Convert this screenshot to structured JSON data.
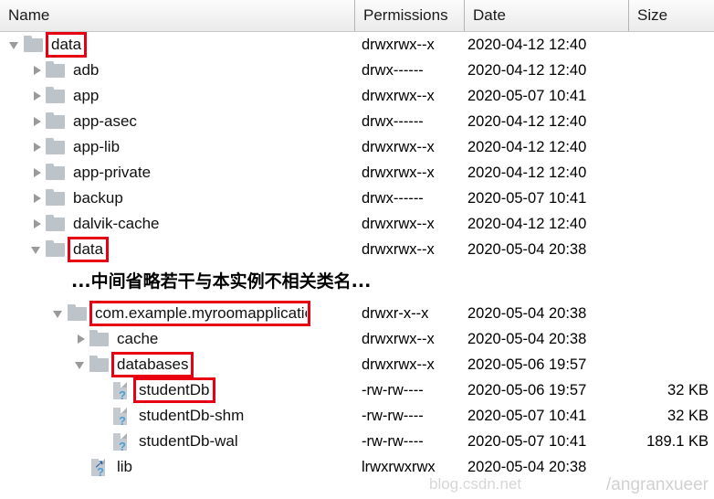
{
  "columns": {
    "name": "Name",
    "permissions": "Permissions",
    "date": "Date",
    "size": "Size"
  },
  "note": {
    "text": "...中间省略若干与本实例不相关类名..."
  },
  "watermark": {
    "text": "/angranxueer",
    "text2": "blog.csdn.net"
  },
  "colors": {
    "highlight": "#e60012",
    "folder": "#bcc3c9",
    "file": "#c4cad0",
    "badge": "#4a9fd8",
    "header_bg": "#f3f3f3"
  },
  "rows": [
    {
      "name": "data",
      "indent": 0,
      "icon": "folder-icon",
      "twisty": "expanded",
      "permissions": "drwxrwx--x",
      "date": "2020-04-12 12:40",
      "size": "",
      "highlight": true
    },
    {
      "name": "adb",
      "indent": 1,
      "icon": "folder-icon",
      "twisty": "collapsed",
      "permissions": "drwx------",
      "date": "2020-04-12 12:40",
      "size": "",
      "highlight": false
    },
    {
      "name": "app",
      "indent": 1,
      "icon": "folder-icon",
      "twisty": "collapsed",
      "permissions": "drwxrwx--x",
      "date": "2020-05-07 10:41",
      "size": "",
      "highlight": false
    },
    {
      "name": "app-asec",
      "indent": 1,
      "icon": "folder-icon",
      "twisty": "collapsed",
      "permissions": "drwx------",
      "date": "2020-04-12 12:40",
      "size": "",
      "highlight": false
    },
    {
      "name": "app-lib",
      "indent": 1,
      "icon": "folder-icon",
      "twisty": "collapsed",
      "permissions": "drwxrwx--x",
      "date": "2020-04-12 12:40",
      "size": "",
      "highlight": false
    },
    {
      "name": "app-private",
      "indent": 1,
      "icon": "folder-icon",
      "twisty": "collapsed",
      "permissions": "drwxrwx--x",
      "date": "2020-04-12 12:40",
      "size": "",
      "highlight": false
    },
    {
      "name": "backup",
      "indent": 1,
      "icon": "folder-icon",
      "twisty": "collapsed",
      "permissions": "drwx------",
      "date": "2020-05-07 10:41",
      "size": "",
      "highlight": false
    },
    {
      "name": "dalvik-cache",
      "indent": 1,
      "icon": "folder-icon",
      "twisty": "collapsed",
      "permissions": "drwxrwx--x",
      "date": "2020-04-12 12:40",
      "size": "",
      "highlight": false
    },
    {
      "name": "data",
      "indent": 1,
      "icon": "folder-icon",
      "twisty": "expanded",
      "permissions": "drwxrwx--x",
      "date": "2020-05-04 20:38",
      "size": "",
      "highlight": true
    },
    {
      "name": "com.example.myroomapplicatio",
      "indent": 2,
      "icon": "folder-icon",
      "twisty": "expanded",
      "permissions": "drwxr-x--x",
      "date": "2020-05-04 20:38",
      "size": "",
      "highlight": true,
      "wide": true
    },
    {
      "name": "cache",
      "indent": 3,
      "icon": "folder-icon",
      "twisty": "collapsed",
      "permissions": "drwxrwx--x",
      "date": "2020-05-04 20:38",
      "size": "",
      "highlight": false
    },
    {
      "name": "databases",
      "indent": 3,
      "icon": "folder-icon",
      "twisty": "expanded",
      "permissions": "drwxrwx--x",
      "date": "2020-05-06 19:57",
      "size": "",
      "highlight": true
    },
    {
      "name": "studentDb",
      "indent": 4,
      "icon": "file-unknown-icon",
      "twisty": "none",
      "permissions": "-rw-rw----",
      "date": "2020-05-06 19:57",
      "size": "32 KB",
      "highlight": true
    },
    {
      "name": "studentDb-shm",
      "indent": 4,
      "icon": "file-unknown-icon",
      "twisty": "none",
      "permissions": "-rw-rw----",
      "date": "2020-05-07 10:41",
      "size": "32 KB",
      "highlight": false
    },
    {
      "name": "studentDb-wal",
      "indent": 4,
      "icon": "file-unknown-icon",
      "twisty": "none",
      "permissions": "-rw-rw----",
      "date": "2020-05-07 10:41",
      "size": "189.1 KB",
      "highlight": false
    },
    {
      "name": "lib",
      "indent": 3,
      "icon": "symlink-icon",
      "twisty": "none",
      "permissions": "lrwxrwxrwx",
      "date": "2020-05-04 20:38",
      "size": "",
      "highlight": false
    }
  ],
  "note_after_row_index": 8
}
